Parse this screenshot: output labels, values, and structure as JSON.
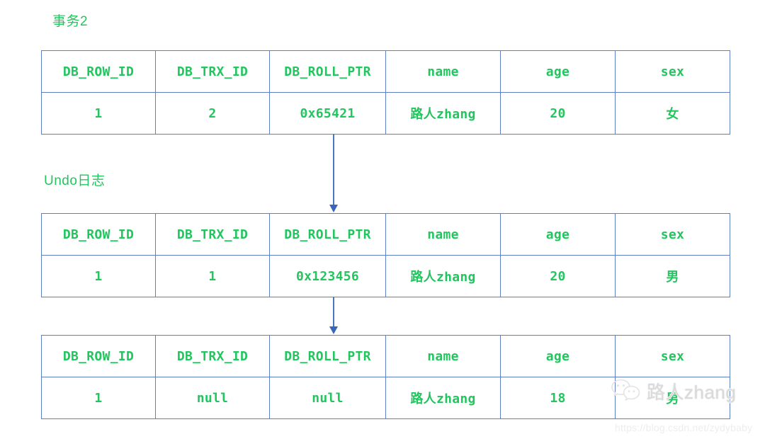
{
  "labels": {
    "transaction": "事务2",
    "undo_log": "Undo日志"
  },
  "colors": {
    "text_green": "#22c55e",
    "border_blue": "#5f7fc4",
    "arrow_blue": "#4a77c4",
    "watermark_gray": "#d9d9d9"
  },
  "columns": [
    "DB_ROW_ID",
    "DB_TRX_ID",
    "DB_ROLL_PTR",
    "name",
    "age",
    "sex"
  ],
  "tables": [
    {
      "id": "current-record",
      "headers": [
        "DB_ROW_ID",
        "DB_TRX_ID",
        "DB_ROLL_PTR",
        "name",
        "age",
        "sex"
      ],
      "row": [
        "1",
        "2",
        "0x65421",
        "路人zhang",
        "20",
        "女"
      ]
    },
    {
      "id": "undo-record-1",
      "headers": [
        "DB_ROW_ID",
        "DB_TRX_ID",
        "DB_ROLL_PTR",
        "name",
        "age",
        "sex"
      ],
      "row": [
        "1",
        "1",
        "0x123456",
        "路人zhang",
        "20",
        "男"
      ]
    },
    {
      "id": "undo-record-2",
      "headers": [
        "DB_ROW_ID",
        "DB_TRX_ID",
        "DB_ROLL_PTR",
        "name",
        "age",
        "sex"
      ],
      "row": [
        "1",
        "null",
        "null",
        "路人zhang",
        "18",
        "男"
      ]
    }
  ],
  "watermark": {
    "name": "路人zhang",
    "url": "https://blog.csdn.net/zydybaby"
  }
}
